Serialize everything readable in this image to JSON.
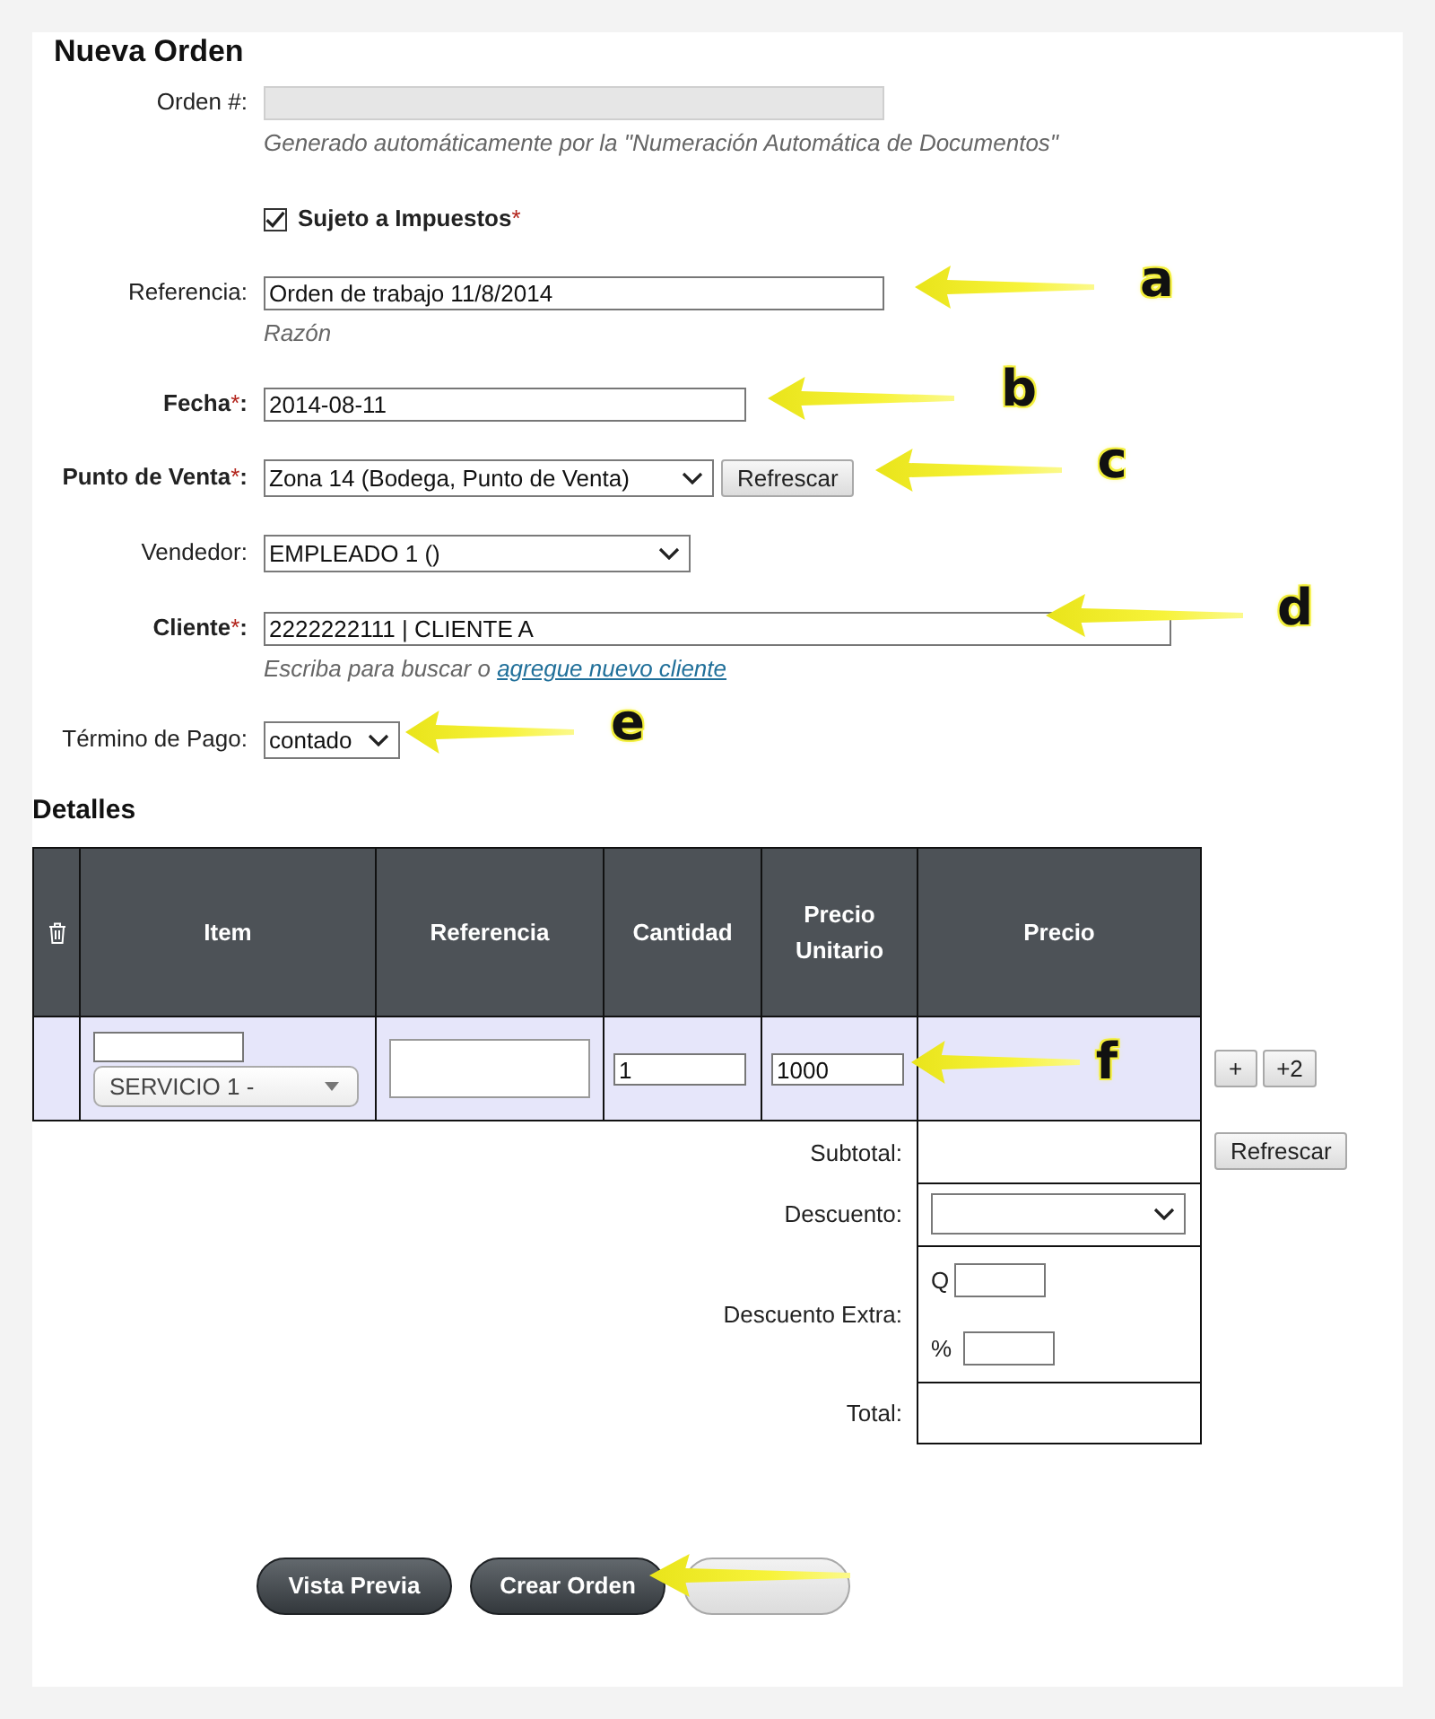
{
  "title": "Nueva Orden",
  "form": {
    "fields": [
      {
        "kind": "readonly",
        "label": "Orden #",
        "colon": ":",
        "hint": "Generado automáticamente por la \"Numeración Automática de Documentos\""
      },
      {
        "kind": "checkbox",
        "label": "Sujeto a Impuestos",
        "required_mark": "*",
        "checked": true
      },
      {
        "kind": "text",
        "label": "Referencia",
        "colon": ":",
        "value": "Orden de trabajo 11/8/2014",
        "hint": "Razón"
      },
      {
        "kind": "text",
        "label": "Fecha",
        "required_mark": "*",
        "colon": ":",
        "value": "2014-08-11"
      },
      {
        "kind": "select",
        "label": "Punto de Venta",
        "required_mark": "*",
        "colon": ":",
        "value": "Zona 14 (Bodega, Punto de Venta)",
        "button": "Refrescar"
      },
      {
        "kind": "select",
        "label": "Vendedor",
        "colon": ":",
        "value": "EMPLEADO 1 ()"
      },
      {
        "kind": "text",
        "label": "Cliente",
        "required_mark": "*",
        "colon": ":",
        "value": "2222222111 | CLIENTE A",
        "hint": "Escriba para buscar o ",
        "hint_link": "agregue nuevo cliente"
      },
      {
        "kind": "select",
        "label": "Término de Pago",
        "colon": ":",
        "value": "contado"
      }
    ]
  },
  "details": {
    "title": "Detalles",
    "columns": [
      {
        "kind": "icon"
      },
      {
        "kind": "item",
        "label": "Item"
      },
      {
        "kind": "reference",
        "label": "Referencia"
      },
      {
        "kind": "quantity",
        "label": "Cantidad"
      },
      {
        "kind": "unit_price",
        "label": "Precio Unitario"
      },
      {
        "kind": "price",
        "label": "Precio"
      }
    ],
    "rows": [
      {
        "item": "SERVICIO 1 -",
        "quantity": "1",
        "unit_price": "1000",
        "buttons": [
          "+",
          "+2"
        ]
      }
    ],
    "totals": [
      {
        "kind": "plain",
        "label": "Subtotal:",
        "button": "Refrescar"
      },
      {
        "kind": "select",
        "label": "Descuento:"
      },
      {
        "kind": "extra",
        "label": "Descuento Extra:",
        "prefixes": [
          "Q",
          "%"
        ]
      },
      {
        "kind": "plain",
        "label": "Total:"
      }
    ]
  },
  "actions": [
    {
      "kind": "dark",
      "label": "Vista Previa"
    },
    {
      "kind": "dark",
      "label": "Crear Orden"
    },
    {
      "kind": "light"
    }
  ],
  "annotations": [
    {
      "kind": "lettered",
      "letter": "a"
    },
    {
      "kind": "lettered",
      "letter": "b"
    },
    {
      "kind": "lettered",
      "letter": "c"
    },
    {
      "kind": "lettered",
      "letter": "d"
    },
    {
      "kind": "lettered",
      "letter": "e"
    },
    {
      "kind": "lettered",
      "letter": "f"
    },
    {
      "kind": "plain"
    }
  ]
}
